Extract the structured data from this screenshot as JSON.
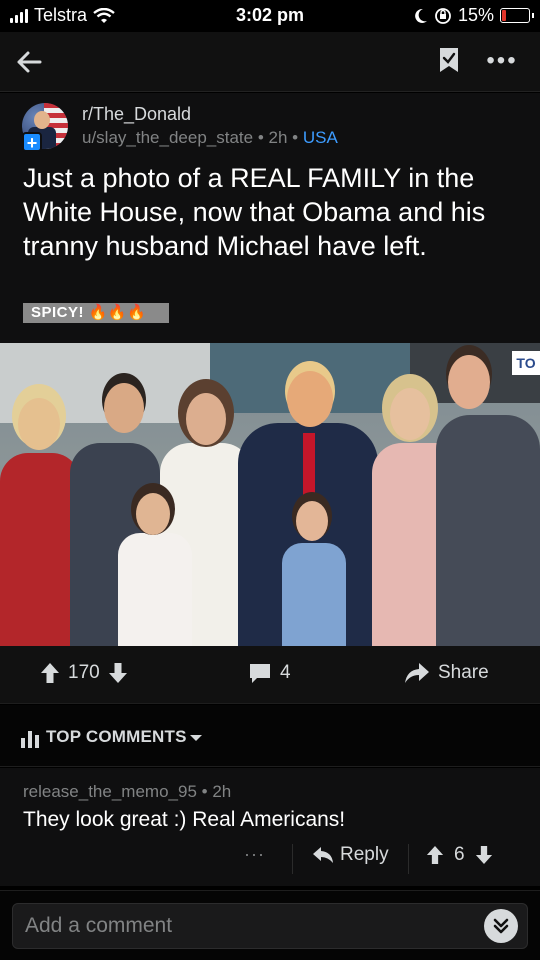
{
  "status_bar": {
    "carrier": "Telstra",
    "time": "3:02 pm",
    "battery_percent": "15%",
    "battery_level": 0.15
  },
  "nav": {
    "back_icon": "arrow-left-icon",
    "save_icon": "bookmark-check-icon",
    "more_icon": "more-horizontal-icon"
  },
  "post": {
    "subreddit": "r/The_Donald",
    "author": "u/slay_the_deep_state",
    "age": "2h",
    "separator": "•",
    "flair": "USA",
    "title": "Just a photo of a REAL FAMILY in the White House, now that Obama and his tranny husband Michael have left.",
    "tag": "SPICY! 🔥🔥🔥"
  },
  "photo": {
    "sign_text": "TO"
  },
  "actions": {
    "score": "170",
    "comments": "4",
    "share_label": "Share"
  },
  "top_comments": {
    "label": "TOP COMMENTS"
  },
  "comment": {
    "author": "release_the_memo_95",
    "age": "2h",
    "separator": "•",
    "body": "They look great :) Real Americans!",
    "more": "···",
    "reply_label": "Reply",
    "score": "6"
  },
  "footer": {
    "placeholder": "Add a comment"
  },
  "colors": {
    "accent_blue": "#1a8cff",
    "flair_blue": "#3d9cff",
    "battery_red": "#e0352b"
  }
}
